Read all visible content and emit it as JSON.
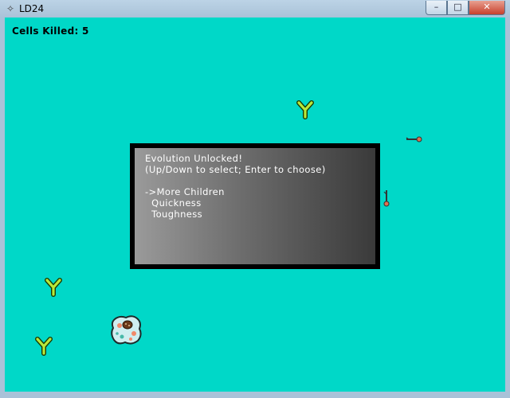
{
  "window": {
    "title": "LD24",
    "minimize_glyph": "–",
    "maximize_glyph": "□",
    "close_glyph": "✕"
  },
  "hud": {
    "kills_label": "Cells Killed:",
    "kills_value": "5"
  },
  "dialog": {
    "heading": "Evolution Unlocked!",
    "instructions": "(Up/Down to select; Enter to choose)",
    "cursor": "->",
    "options": [
      "More Children",
      "Quickness",
      "Toughness"
    ],
    "selected_index": 0
  },
  "colors": {
    "background": "#00d8c8",
    "antibody_fill": "#b8e83a",
    "antibody_outline": "#1a3a00",
    "dialog_border": "#000000",
    "dialog_text": "#ffffff"
  },
  "icons": [
    "antibody-icon",
    "player-cell-icon",
    "bacterium-icon"
  ]
}
